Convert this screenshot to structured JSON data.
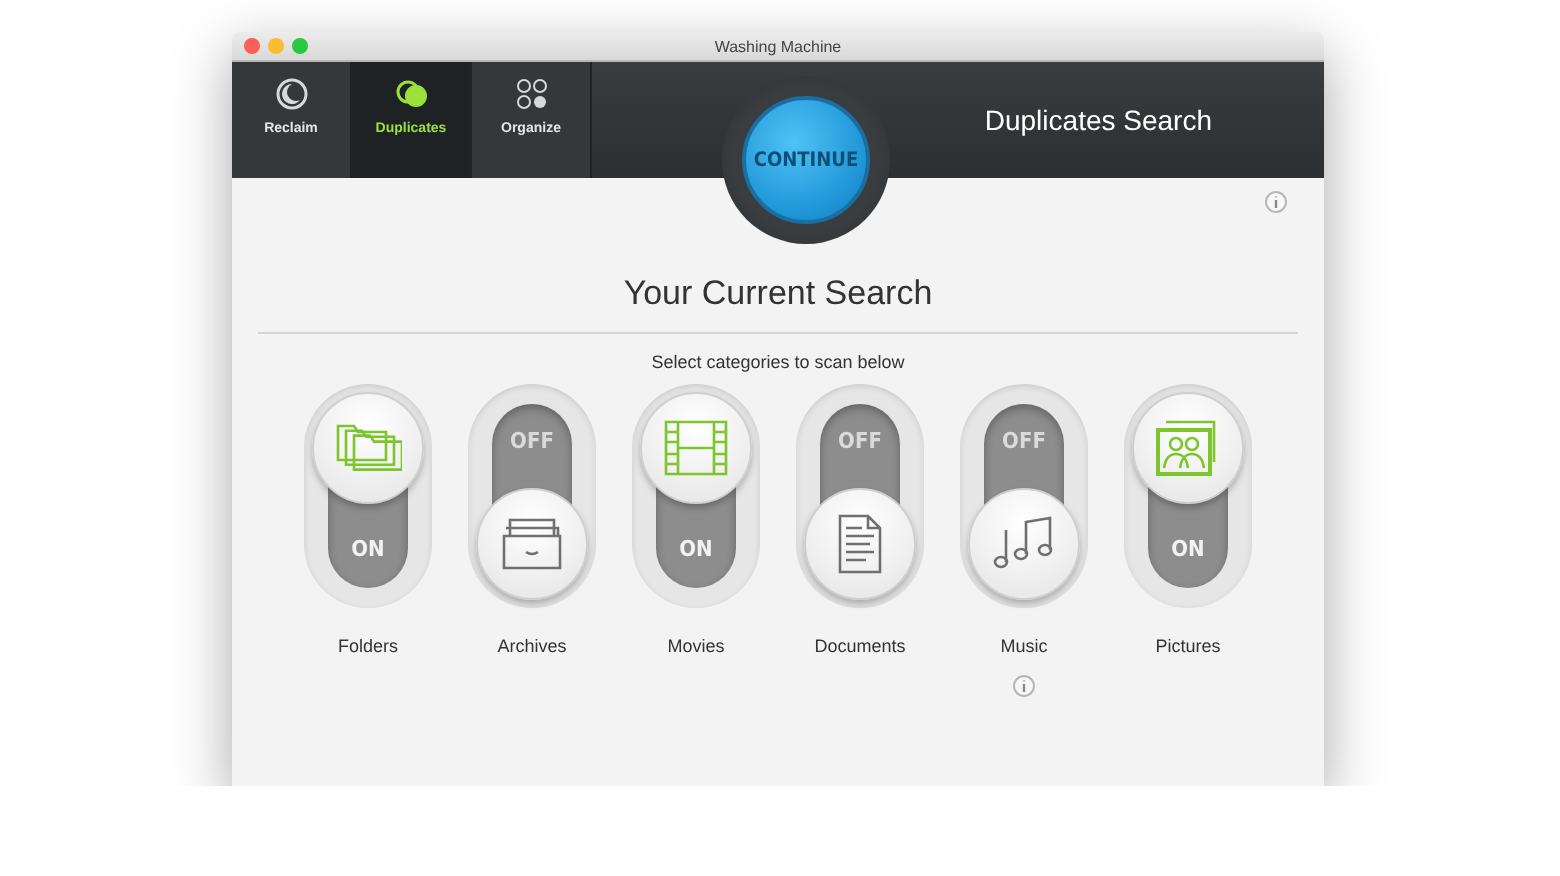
{
  "window": {
    "title": "Washing Machine"
  },
  "tabs": [
    {
      "label": "Reclaim",
      "selected": false
    },
    {
      "label": "Duplicates",
      "selected": true
    },
    {
      "label": "Organize",
      "selected": false
    }
  ],
  "continue_button": "CONTINUE",
  "header_title": "Duplicates Search",
  "heading": "Your Current Search",
  "subheading": "Select categories to scan below",
  "categories": [
    {
      "name": "Folders",
      "on": true,
      "switch_label": "ON"
    },
    {
      "name": "Archives",
      "on": false,
      "switch_label": "OFF"
    },
    {
      "name": "Movies",
      "on": true,
      "switch_label": "ON"
    },
    {
      "name": "Documents",
      "on": false,
      "switch_label": "OFF"
    },
    {
      "name": "Music",
      "on": false,
      "switch_label": "OFF"
    },
    {
      "name": "Pictures",
      "on": true,
      "switch_label": "ON"
    }
  ]
}
